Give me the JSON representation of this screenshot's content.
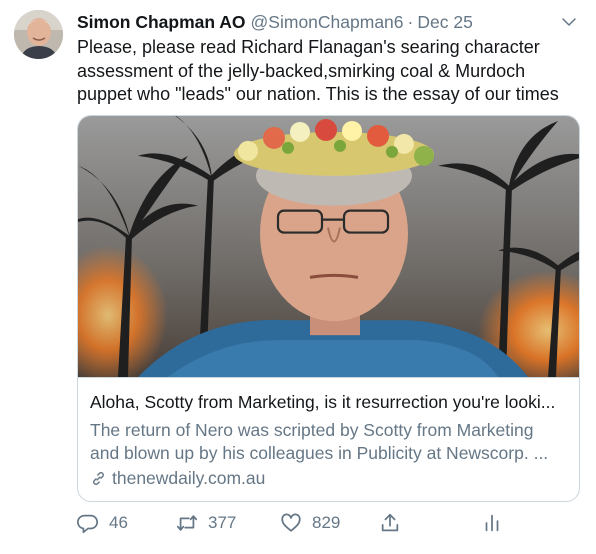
{
  "tweet": {
    "author_name": "Simon Chapman AO",
    "author_handle": "@SimonChapman6",
    "separator": "·",
    "date": "Dec 25",
    "text": "Please, please read Richard Flanagan's searing character\nassessment of the jelly-backed,smirking coal & Murdoch\npuppet  who \"leads\" our nation.  This is the essay of our times"
  },
  "card": {
    "title": "Aloha, Scotty from Marketing, is it resurrection you're looki...",
    "description": "The return of Nero was scripted by Scotty from Marketing\nand blown up by his colleagues in Publicity at Newscorp. ...",
    "domain": "thenewdaily.com.au"
  },
  "actions": {
    "replies": "46",
    "retweets": "377",
    "likes": "829"
  },
  "icons": {
    "more": "chevron-down-icon",
    "link": "link-icon",
    "reply": "reply-icon",
    "retweet": "retweet-icon",
    "like": "heart-icon",
    "share": "share-icon",
    "analytics": "analytics-icon"
  },
  "colors": {
    "text_primary": "#14171a",
    "text_secondary": "#657786",
    "border": "#ccd6dd"
  }
}
